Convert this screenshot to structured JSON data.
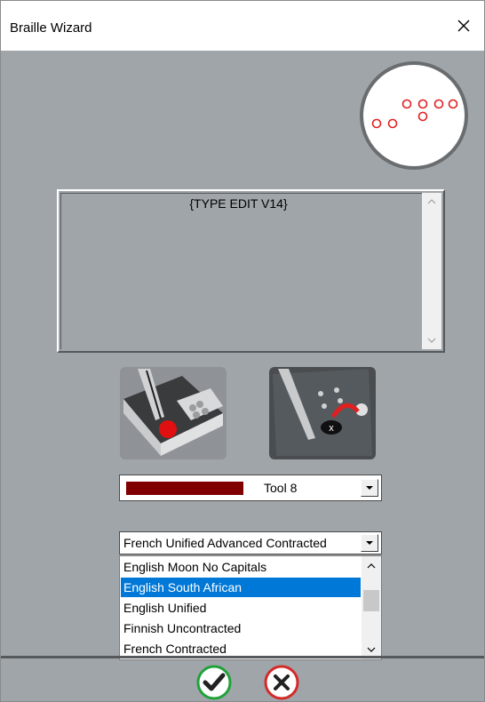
{
  "window": {
    "title": "Braille Wizard"
  },
  "preview": {
    "icon": "braille-dots-preview"
  },
  "editor": {
    "text": "{TYPE EDIT V14}"
  },
  "tools": {
    "emboss_icon": "emboss-tool-icon",
    "erase_icon": "erase-dot-tool-icon",
    "selected_tool": "Tool 8",
    "tool_color": "#800000"
  },
  "language": {
    "selected": "French Unified Advanced Contracted",
    "options": [
      "English Moon No Capitals",
      "English South African",
      "English Unified",
      "Finnish Uncontracted",
      "French Contracted"
    ],
    "highlighted": "English South African"
  },
  "buttons": {
    "ok_icon": "check-icon",
    "cancel_icon": "x-icon"
  },
  "colors": {
    "dialog_bg": "#a0a5a9",
    "selection": "#0078d7",
    "ok": "#1fa23a",
    "cancel": "#d42a2a"
  }
}
